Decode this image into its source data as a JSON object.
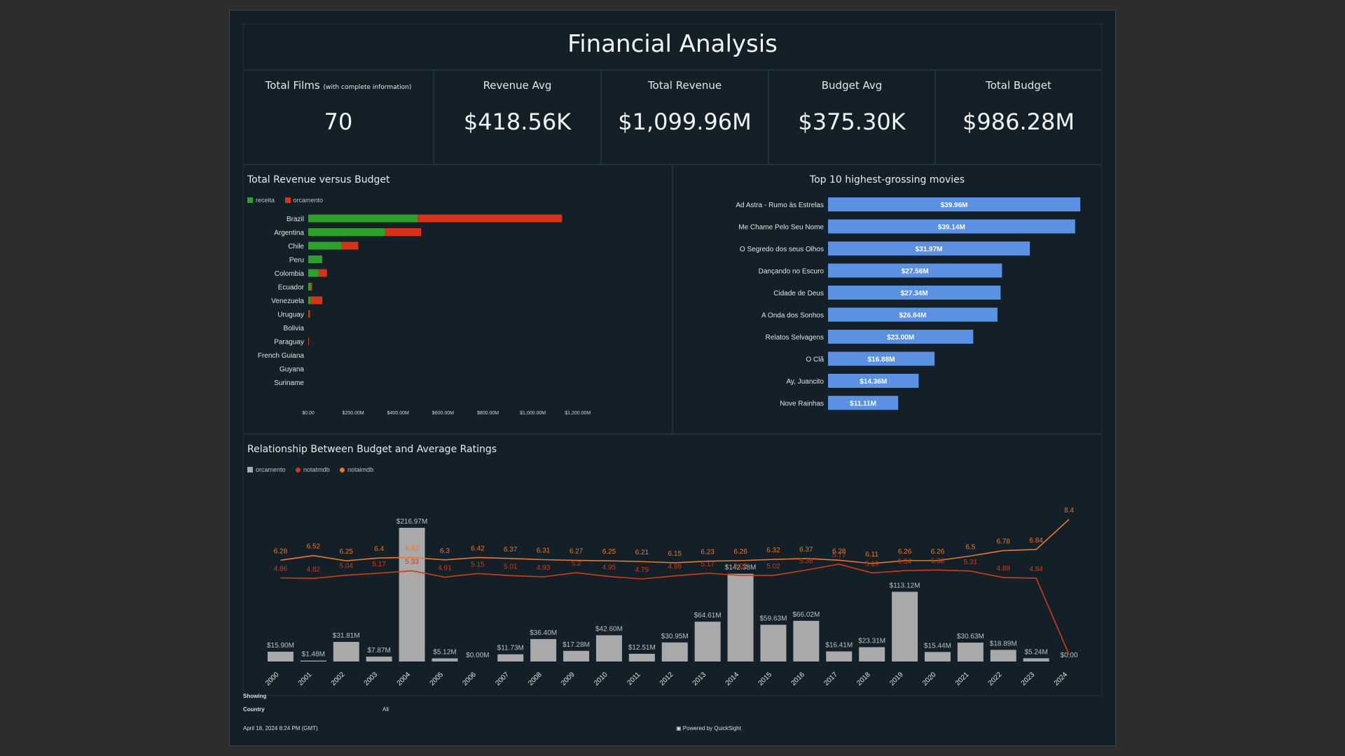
{
  "title": "Financial Analysis",
  "kpis": [
    {
      "label": "Total Films",
      "note": "(with complete information)",
      "value": "70"
    },
    {
      "label": "Revenue Avg",
      "note": "",
      "value": "$418.56K"
    },
    {
      "label": "Total Revenue",
      "note": "",
      "value": "$1,099.96M"
    },
    {
      "label": "Budget Avg",
      "note": "",
      "value": "$375.30K"
    },
    {
      "label": "Total Budget",
      "note": "",
      "value": "$986.28M"
    }
  ],
  "colors": {
    "receita": "#2ea12b",
    "orcamento": "#d6331a",
    "top10": "#5a91e2",
    "budget_bar": "#a9a9a9",
    "notatmdb": "#d23a16",
    "notaimdb": "#e7782b"
  },
  "chart_data": [
    {
      "type": "bar",
      "title": "Total Revenue versus Budget",
      "orientation": "horizontal-stacked",
      "legend": [
        "receita",
        "orcamento"
      ],
      "legend_position": "top-left",
      "categories": [
        "Brazil",
        "Argentina",
        "Chile",
        "Peru",
        "Colombia",
        "Ecuador",
        "Venezuela",
        "Uruguay",
        "Bolivia",
        "Paraguay",
        "French Guiana",
        "Guyana",
        "Suriname"
      ],
      "series": [
        {
          "name": "receita",
          "values": [
            487,
            342,
            148,
            62,
            46,
            12,
            10,
            1,
            0,
            0,
            0,
            0,
            0
          ]
        },
        {
          "name": "orcamento",
          "values": [
            643,
            161,
            75,
            0,
            37,
            5,
            53,
            7,
            0,
            3,
            0,
            0,
            0
          ]
        }
      ],
      "xlim": [
        0,
        1260
      ],
      "xticks": [
        0,
        200,
        400,
        600,
        800,
        1000,
        1200
      ],
      "xtick_labels": [
        "$0.00",
        "$200.00M",
        "$400.00M",
        "$600.00M",
        "$800.00M",
        "$1,000.00M",
        "$1,200.00M"
      ],
      "unit": "$M"
    },
    {
      "type": "bar",
      "title": "Top 10 highest-grossing movies",
      "orientation": "horizontal",
      "categories": [
        "Ad Astra - Rumo às Estrelas",
        "Me Chame Pelo Seu Nome",
        "O Segredo dos seus Olhos",
        "Dançando no Escuro",
        "Cidade de Deus",
        "A Onda dos Sonhos",
        "Relatos Selvagens",
        "O Clã",
        "Ay, Juancito",
        "Nove Rainhas"
      ],
      "values": [
        39.96,
        39.14,
        31.97,
        27.56,
        27.34,
        26.84,
        23.0,
        16.88,
        14.36,
        11.11
      ],
      "data_labels": [
        "$39.96M",
        "$39.14M",
        "$31.97M",
        "$27.56M",
        "$27.34M",
        "$26.84M",
        "$23.00M",
        "$16.88M",
        "$14.36M",
        "$11.11M"
      ],
      "xlim": [
        0,
        40.5
      ]
    },
    {
      "type": "bar",
      "title": "Relationship Between Budget and Average Ratings",
      "legend": [
        "orcamento",
        "notatmdb",
        "notaimdb"
      ],
      "legend_position": "top-left",
      "categories": [
        "2000",
        "2001",
        "2002",
        "2003",
        "2004",
        "2005",
        "2006",
        "2007",
        "2008",
        "2009",
        "2010",
        "2011",
        "2012",
        "2013",
        "2014",
        "2015",
        "2016",
        "2017",
        "2018",
        "2019",
        "2020",
        "2021",
        "2022",
        "2023",
        "2024"
      ],
      "series": [
        {
          "name": "orcamento",
          "type": "bar",
          "values": [
            15.9,
            1.48,
            31.81,
            7.87,
            216.97,
            5.12,
            0.0,
            11.73,
            36.4,
            17.28,
            42.6,
            12.51,
            30.95,
            64.61,
            142.38,
            59.63,
            66.02,
            16.41,
            23.31,
            113.12,
            15.44,
            30.63,
            18.89,
            5.24,
            0.0
          ],
          "labels": [
            "$15.90M",
            "$1.48M",
            "$31.81M",
            "$7.87M",
            "$216.97M",
            "$5.12M",
            "$0.00M",
            "$11.73M",
            "$36.40M",
            "$17.28M",
            "$42.60M",
            "$12.51M",
            "$30.95M",
            "$64.61M",
            "$142.38M",
            "$59.63M",
            "$66.02M",
            "$16.41M",
            "$23.31M",
            "$113.12M",
            "$15.44M",
            "$30.63M",
            "$18.89M",
            "$5.24M",
            "$0.00"
          ]
        },
        {
          "name": "notatmdb",
          "type": "line",
          "values": [
            4.86,
            4.82,
            5.04,
            5.17,
            5.33,
            4.91,
            5.15,
            5.01,
            4.93,
            5.2,
            4.95,
            4.79,
            4.99,
            5.17,
            5.02,
            5.02,
            5.38,
            5.77,
            5.19,
            5.34,
            5.38,
            5.31,
            4.88,
            4.84,
            null
          ],
          "labels": [
            "4.86",
            "4.82",
            "5.04",
            "5.17",
            "5.33",
            "4.91",
            "5.15",
            "5.01",
            "4.93",
            "5.2",
            "4.95",
            "4.79",
            "4.99",
            "5.17",
            "5.02",
            "5.02",
            "5.38",
            "5.77",
            "5.19",
            "5.34",
            "5.38",
            "5.31",
            "4.88",
            "4.84",
            ""
          ]
        },
        {
          "name": "notaimdb",
          "type": "line",
          "values": [
            6.28,
            6.52,
            6.25,
            6.4,
            6.42,
            6.3,
            6.42,
            6.37,
            6.31,
            6.27,
            6.25,
            6.21,
            6.15,
            6.23,
            6.26,
            6.32,
            6.37,
            6.28,
            6.11,
            6.26,
            6.26,
            6.5,
            6.78,
            6.84,
            8.4
          ],
          "labels": [
            "6.28",
            "6.52",
            "6.25",
            "6.4",
            "6.42",
            "6.3",
            "6.42",
            "6.37",
            "6.31",
            "6.27",
            "6.25",
            "6.21",
            "6.15",
            "6.23",
            "6.26",
            "6.32",
            "6.37",
            "6.28",
            "6.11",
            "6.26",
            "6.26",
            "6.5",
            "6.78",
            "6.84",
            "8.4"
          ]
        }
      ],
      "bar_ylim": [
        0,
        230
      ],
      "line_ylim": [
        0,
        9.5
      ]
    }
  ],
  "footer": {
    "showing": "Showing",
    "country_label": "Country",
    "country_value": "All",
    "date": "April 18, 2024 8:24 PM (GMT)",
    "powered": "Powered by QuickSight"
  }
}
